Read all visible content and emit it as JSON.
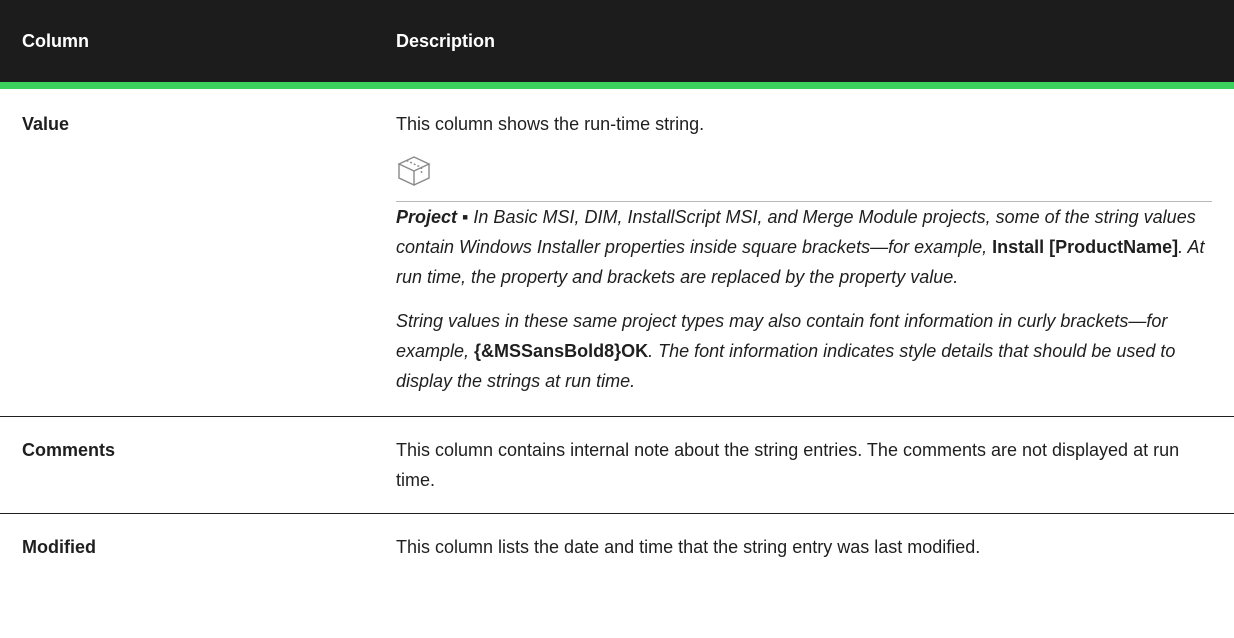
{
  "table": {
    "headers": {
      "column": "Column",
      "description": "Description"
    },
    "rows": [
      {
        "name": "Value",
        "description": "This column shows the run-time string.",
        "note": {
          "icon": "project-box-icon",
          "label": "Project",
          "separator": " ▪ ",
          "para1_a": "In Basic MSI, DIM, InstallScript MSI, and Merge Module projects, some of the string values contain Windows Installer properties inside square brackets—for example, ",
          "para1_code": "Install [ProductName]",
          "para1_b": ". At run time, the property and brackets are replaced by the property value.",
          "para2_a": "String values in these same project types may also contain font information in curly brackets—for example, ",
          "para2_code": "{&MSSansBold8}OK",
          "para2_b": ". The font information indicates style details that should be used to display the strings at run time."
        }
      },
      {
        "name": "Comments",
        "description": "This column contains internal note about the string entries. The comments are not displayed at run time."
      },
      {
        "name": "Modified",
        "description": "This column lists the date and time that the string entry was last modified."
      }
    ]
  },
  "colors": {
    "header_bg": "#1c1c1c",
    "accent": "#3ad15c"
  }
}
